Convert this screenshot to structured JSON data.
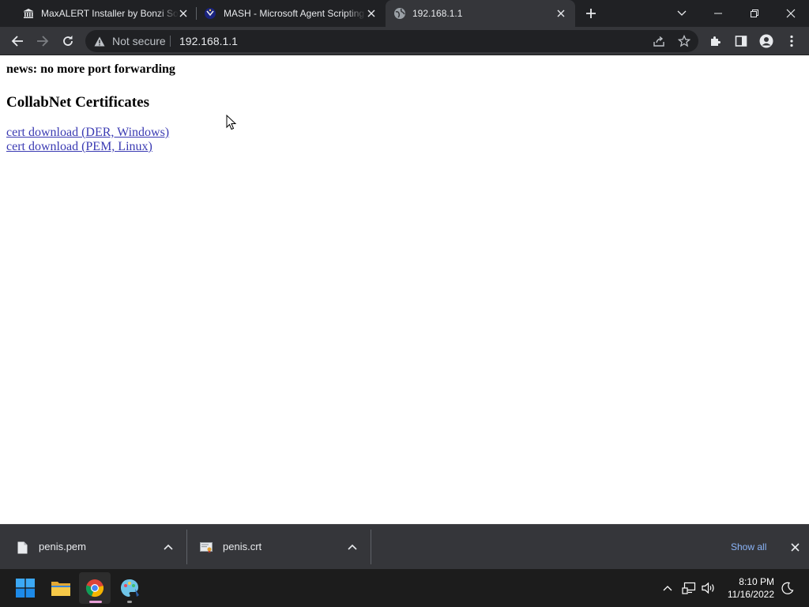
{
  "browser": {
    "tabs": [
      {
        "title": "MaxALERT Installer by Bonzi Software",
        "favicon": "bank-building-icon",
        "active": false
      },
      {
        "title": "MASH - Microsoft Agent Scripting Helper",
        "favicon": "agent-wizard-icon",
        "active": false
      },
      {
        "title": "192.168.1.1",
        "favicon": "globe-icon",
        "active": true
      }
    ],
    "omnibox": {
      "security_label": "Not secure",
      "url": "192.168.1.1"
    }
  },
  "page": {
    "news": "news: no more port forwarding",
    "heading": "CollabNet Certificates",
    "links": [
      {
        "label": "cert download (DER, Windows)"
      },
      {
        "label": "cert download (PEM, Linux)"
      }
    ]
  },
  "downloads": {
    "items": [
      {
        "filename": "penis.pem",
        "icon": "document-file-icon"
      },
      {
        "filename": "penis.crt",
        "icon": "certificate-file-icon"
      }
    ],
    "show_all_label": "Show all"
  },
  "taskbar": {
    "apps": [
      {
        "name": "windows-start-icon"
      },
      {
        "name": "file-explorer-icon"
      },
      {
        "name": "chrome-icon",
        "active": true
      },
      {
        "name": "paint-icon"
      }
    ],
    "clock": {
      "time": "8:10 PM",
      "date": "11/16/2022"
    }
  },
  "colors": {
    "titlebar": "#202124",
    "toolbar": "#35363a",
    "link": "#3b3bb3",
    "show_all": "#8ab4f8",
    "taskbar": "#1c1c1c"
  }
}
